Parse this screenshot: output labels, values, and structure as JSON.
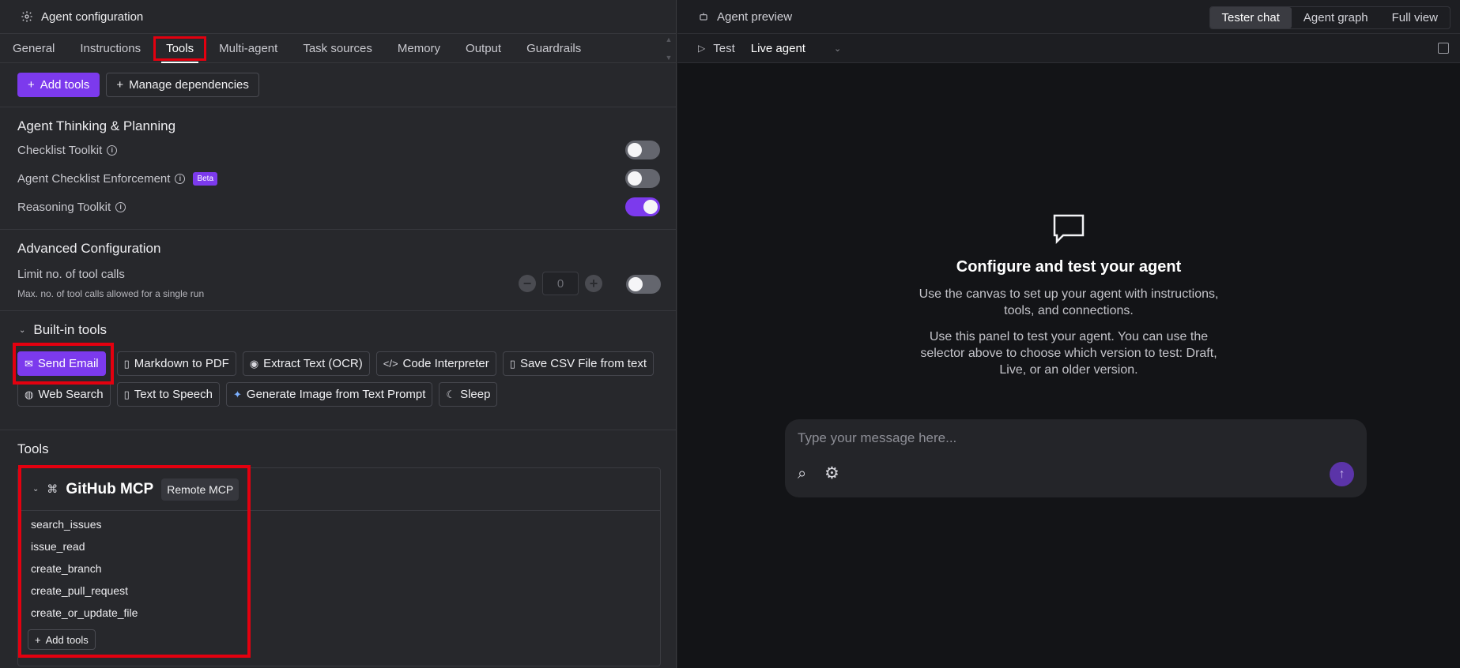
{
  "left_header": {
    "title": "Agent configuration",
    "icon": "gear-icon"
  },
  "tabs": [
    {
      "label": "General"
    },
    {
      "label": "Instructions"
    },
    {
      "label": "Tools",
      "active": true
    },
    {
      "label": "Multi-agent"
    },
    {
      "label": "Task sources"
    },
    {
      "label": "Memory"
    },
    {
      "label": "Output"
    },
    {
      "label": "Guardrails"
    }
  ],
  "toolbar": {
    "add_tools": "Add tools",
    "manage_dependencies": "Manage dependencies"
  },
  "thinking": {
    "title": "Agent Thinking & Planning",
    "items": [
      {
        "label": "Checklist Toolkit",
        "on": false
      },
      {
        "label": "Agent Checklist Enforcement",
        "badge": "Beta",
        "on": false
      },
      {
        "label": "Reasoning Toolkit",
        "on": true
      }
    ]
  },
  "advanced": {
    "title": "Advanced Configuration",
    "limit_label": "Limit no. of tool calls",
    "limit_help": "Max. no. of tool calls allowed for a single run",
    "limit_value": "0",
    "limit_on": false
  },
  "builtin": {
    "title": "Built-in tools",
    "tools": [
      {
        "label": "Send Email",
        "icon": "mail-icon",
        "selected": true
      },
      {
        "label": "Markdown to PDF",
        "icon": "file-pdf-icon"
      },
      {
        "label": "Extract Text (OCR)",
        "icon": "eye-icon"
      },
      {
        "label": "Code Interpreter",
        "icon": "code-icon"
      },
      {
        "label": "Save CSV File from text",
        "icon": "file-icon"
      },
      {
        "label": "Web Search",
        "icon": "globe-search-icon"
      },
      {
        "label": "Text to Speech",
        "icon": "speech-file-icon"
      },
      {
        "label": "Generate Image from Text Prompt",
        "icon": "sparkle-icon"
      },
      {
        "label": "Sleep",
        "icon": "moon-icon"
      }
    ]
  },
  "tools_section": {
    "title": "Tools",
    "mcp": {
      "name": "GitHub MCP",
      "tag": "Remote MCP",
      "items": [
        "search_issues",
        "issue_read",
        "create_branch",
        "create_pull_request",
        "create_or_update_file"
      ],
      "add_label": "Add tools"
    }
  },
  "right_header": {
    "title": "Agent preview",
    "view_tabs": [
      "Tester chat",
      "Agent graph",
      "Full view"
    ],
    "active_view": "Tester chat"
  },
  "test_bar": {
    "label": "Test",
    "selected": "Live agent"
  },
  "empty_state": {
    "title": "Configure and test your agent",
    "p1": "Use the canvas to set up your agent with instructions, tools, and connections.",
    "p2": "Use this panel to test your agent. You can use the selector above to choose which version to test: Draft, Live, or an older version."
  },
  "composer": {
    "placeholder": "Type your message here..."
  },
  "colors": {
    "accent": "#7c3aed",
    "highlight": "#e3000f"
  }
}
